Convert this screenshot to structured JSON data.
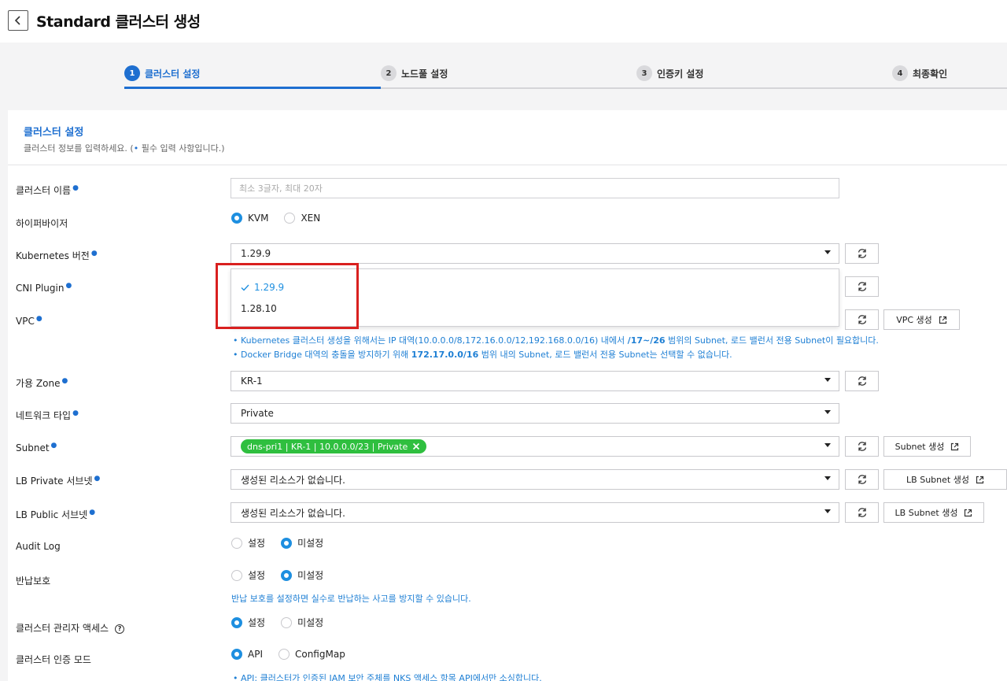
{
  "header": {
    "title": "Standard 클러스터 생성",
    "back_icon": "chevron-left-icon"
  },
  "stepper": {
    "steps": [
      {
        "num": "1",
        "label": "클러스터 설정",
        "active": true
      },
      {
        "num": "2",
        "label": "노드풀 설정",
        "active": false
      },
      {
        "num": "3",
        "label": "인증키 설정",
        "active": false
      },
      {
        "num": "4",
        "label": "최종확인",
        "active": false
      }
    ]
  },
  "section": {
    "title": "클러스터 설정",
    "desc_prefix": "클러스터 정보를 입력하세요. (",
    "desc_dot": "•",
    "desc_suffix": " 필수 입력 사항입니다.)"
  },
  "fields": {
    "cluster_name": {
      "label": "클러스터 이름",
      "placeholder": "최소 3글자, 최대 20자"
    },
    "hypervisor": {
      "label": "하이퍼바이저",
      "options": [
        "KVM",
        "XEN"
      ],
      "selected": "KVM"
    },
    "k8s_version": {
      "label": "Kubernetes 버전",
      "value": "1.29.9"
    },
    "cni_plugin": {
      "label": "CNI Plugin"
    },
    "vpc": {
      "label": "VPC",
      "create_label": "VPC 생성"
    },
    "vpc_notes": {
      "line1_a": "Kubernetes 클러스터 생성을 위해서는 IP 대역(10.0.0.0/8,172.16.0.0/12,192.168.0.0/16) 내에서 ",
      "line1_b": "/17~/26",
      "line1_c": " 범위의 Subnet, 로드 밸런서 전용 Subnet이 필요합니다.",
      "line2_a": "Docker Bridge 대역의 충돌을 방지하기 위해 ",
      "line2_b": "172.17.0.0/16",
      "line2_c": " 범위 내의 Subnet, 로드 밸런서 전용 Subnet는 선택할 수 없습니다."
    },
    "zone": {
      "label": "가용 Zone",
      "value": "KR-1"
    },
    "network_type": {
      "label": "네트워크 타입",
      "value": "Private"
    },
    "subnet": {
      "label": "Subnet",
      "chip": "dns-pri1 | KR-1 | 10.0.0.0/23 | Private",
      "create_label": "Subnet 생성"
    },
    "lb_private": {
      "label": "LB Private 서브넷",
      "value": "생성된 리소스가 없습니다.",
      "create_label": "LB Subnet 생성"
    },
    "lb_public": {
      "label": "LB Public 서브넷",
      "value": "생성된 리소스가 없습니다.",
      "create_label": "LB Subnet 생성"
    },
    "audit_log": {
      "label": "Audit Log",
      "options": [
        "설정",
        "미설정"
      ],
      "selected": "미설정"
    },
    "return_protect": {
      "label": "반납보호",
      "options": [
        "설정",
        "미설정"
      ],
      "selected": "미설정",
      "note": "반납 보호를 설정하면 실수로 반납하는 사고를 방지할 수 있습니다."
    },
    "admin_access": {
      "label": "클러스터 관리자 액세스",
      "help": "?",
      "options": [
        "설정",
        "미설정"
      ],
      "selected": "설정"
    },
    "auth_mode": {
      "label": "클러스터 인증 모드",
      "options": [
        "API",
        "ConfigMap"
      ],
      "selected": "API",
      "note": "API: 클러스터가 인증된 IAM 보안 주체를 NKS 액세스 항목 API에서만 소싱합니다."
    }
  },
  "dropdown": {
    "items": [
      {
        "label": "1.29.9",
        "selected": true
      },
      {
        "label": "1.28.10",
        "selected": false
      }
    ]
  },
  "colors": {
    "accent": "#1e6fd0",
    "chip": "#2fbf3f",
    "highlight": "#d9201f"
  }
}
